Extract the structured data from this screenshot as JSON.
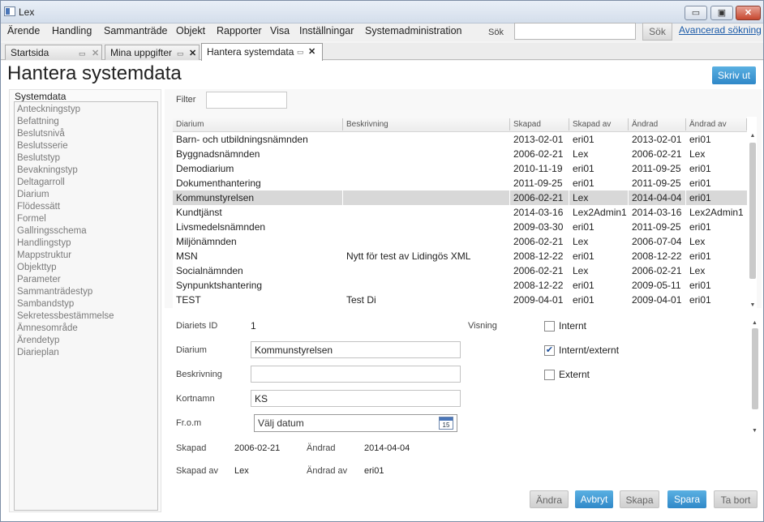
{
  "window": {
    "title": "Lex",
    "minimize": "▭",
    "maximize": "▣",
    "close": "✕"
  },
  "menu": {
    "items": [
      "Ärende",
      "Handling",
      "Sammanträde",
      "Objekt",
      "Rapporter",
      "Visa",
      "Inställningar",
      "Systemadministration"
    ],
    "search_label": "Sök",
    "search_value": "",
    "search_button": "Sök",
    "advanced_search": "Avancerad sökning"
  },
  "tabs": [
    {
      "label": "Startsida",
      "active": false
    },
    {
      "label": "Mina uppgifter",
      "active": false
    },
    {
      "label": "Hantera systemdata",
      "active": true
    }
  ],
  "page": {
    "title": "Hantera systemdata",
    "print_button": "Skriv ut"
  },
  "systemdata": {
    "heading": "Systemdata",
    "items": [
      "Anteckningstyp",
      "Befattning",
      "Beslutsnivå",
      "Beslutsserie",
      "Beslutstyp",
      "Bevakningstyp",
      "Deltagarroll",
      "Diarium",
      "Flödessätt",
      "Formel",
      "Gallringsschema",
      "Handlingstyp",
      "Mappstruktur",
      "Objekttyp",
      "Parameter",
      "Sammanträdestyp",
      "Sambandstyp",
      "Sekretessbestämmelse",
      "Ämnesområde",
      "Ärendetyp",
      "Diarieplan"
    ]
  },
  "filter": {
    "label": "Filter",
    "value": ""
  },
  "grid": {
    "columns": [
      "Diarium",
      "Beskrivning",
      "Skapad",
      "Skapad av",
      "Ändrad",
      "Ändrad av"
    ],
    "selected_index": 4,
    "rows": [
      [
        "Barn- och utbildningsnämnden",
        "",
        "2013-02-01",
        "eri01",
        "2013-02-01",
        "eri01"
      ],
      [
        "Byggnadsnämnden",
        "",
        "2006-02-21",
        "Lex",
        "2006-02-21",
        "Lex"
      ],
      [
        "Demodiarium",
        "",
        "2010-11-19",
        "eri01",
        "2011-09-25",
        "eri01"
      ],
      [
        "Dokumenthantering",
        "",
        "2011-09-25",
        "eri01",
        "2011-09-25",
        "eri01"
      ],
      [
        "Kommunstyrelsen",
        "",
        "2006-02-21",
        "Lex",
        "2014-04-04",
        "eri01"
      ],
      [
        "Kundtjänst",
        "",
        "2014-03-16",
        "Lex2Admin1",
        "2014-03-16",
        "Lex2Admin1"
      ],
      [
        "Livsmedelsnämnden",
        "",
        "2009-03-30",
        "eri01",
        "2011-09-25",
        "eri01"
      ],
      [
        "Miljönämnden",
        "",
        "2006-02-21",
        "Lex",
        "2006-07-04",
        "Lex"
      ],
      [
        "MSN",
        "Nytt för test av Lidingös XML",
        "2008-12-22",
        "eri01",
        "2008-12-22",
        "eri01"
      ],
      [
        "Socialnämnden",
        "",
        "2006-02-21",
        "Lex",
        "2006-02-21",
        "Lex"
      ],
      [
        "Synpunktshantering",
        "",
        "2008-12-22",
        "eri01",
        "2009-05-11",
        "eri01"
      ],
      [
        "TEST",
        "Test Di",
        "2009-04-01",
        "eri01",
        "2009-04-01",
        "eri01"
      ]
    ]
  },
  "detail": {
    "id_label": "Diariets ID",
    "id_value": "1",
    "diarium_label": "Diarium",
    "diarium_value": "Kommunstyrelsen",
    "beskrivning_label": "Beskrivning",
    "beskrivning_value": "",
    "kortnamn_label": "Kortnamn",
    "kortnamn_value": "KS",
    "from_label": "Fr.o.m",
    "from_placeholder": "Välj datum",
    "calendar_day": "15",
    "skapad_label": "Skapad",
    "skapad_value": "2006-02-21",
    "andrad_label": "Ändrad",
    "andrad_value": "2014-04-04",
    "skapad_av_label": "Skapad av",
    "skapad_av_value": "Lex",
    "andrad_av_label": "Ändrad av",
    "andrad_av_value": "eri01",
    "visning_label": "Visning",
    "visning": [
      {
        "label": "Internt",
        "checked": false
      },
      {
        "label": "Internt/externt",
        "checked": true
      },
      {
        "label": "Externt",
        "checked": false
      }
    ]
  },
  "actions": {
    "andra": "Ändra",
    "avbryt": "Avbryt",
    "skapa": "Skapa",
    "spara": "Spara",
    "ta_bort": "Ta bort"
  }
}
